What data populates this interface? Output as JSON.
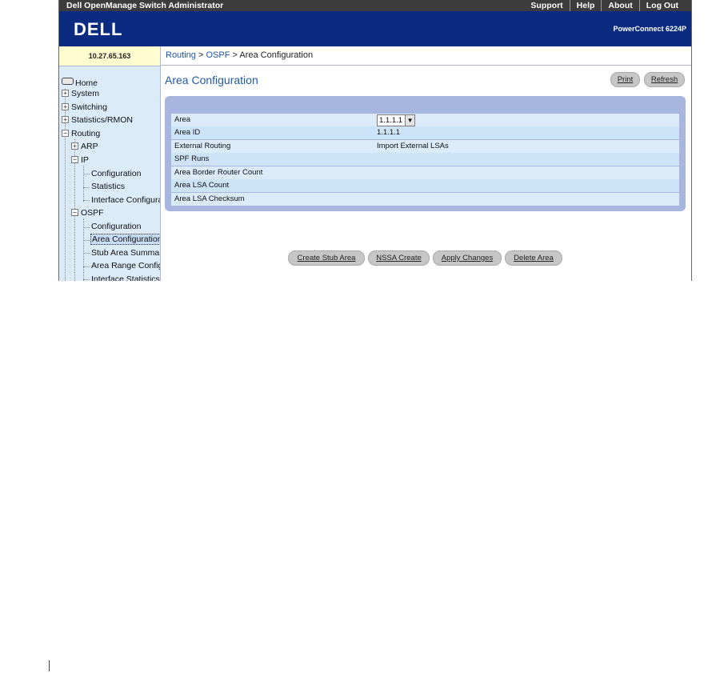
{
  "topbar": {
    "app_title": "Dell OpenManage Switch Administrator",
    "links": [
      "Support",
      "Help",
      "About",
      "Log Out"
    ]
  },
  "banner": {
    "logo_text": "DELL",
    "model": "PowerConnect 6224P"
  },
  "ip_address": "10.27.65.163",
  "breadcrumb": {
    "items": [
      "Routing",
      "OSPF"
    ],
    "current": "Area Configuration",
    "separator": ">"
  },
  "sidebar": {
    "home": "Home",
    "system": "System",
    "switching": "Switching",
    "statistics": "Statistics/RMON",
    "routing": "Routing",
    "arp": "ARP",
    "ip": "IP",
    "ip_configuration": "Configuration",
    "ip_statistics": "Statistics",
    "ip_interface_configuration": "Interface Configuration",
    "ospf": "OSPF",
    "ospf_configuration": "Configuration",
    "ospf_area_configuration": "Area Configuration",
    "ospf_stub_area_summary": "Stub Area Summary",
    "ospf_area_range_configuration": "Area Range Configuration",
    "ospf_interface_statistics": "Interface Statistics",
    "expander_plus": "+",
    "expander_minus": "−"
  },
  "page": {
    "title": "Area Configuration",
    "print_label": "Print",
    "refresh_label": "Refresh"
  },
  "form": {
    "area_label": "Area",
    "area_value": "1.1.1.1",
    "area_id_label": "Area ID",
    "area_id_value": "1.1.1.1",
    "external_routing_label": "External Routing",
    "external_routing_value": "Import External LSAs",
    "spf_runs_label": "SPF Runs",
    "abr_count_label": "Area Border Router Count",
    "lsa_count_label": "Area LSA Count",
    "lsa_checksum_label": "Area LSA Checksum"
  },
  "actions": {
    "create_stub": "Create Stub Area",
    "nssa_create": "NSSA Create",
    "apply_changes": "Apply Changes",
    "delete_area": "Delete Area"
  },
  "colors": {
    "banner": "#0b2b80",
    "topbar": "#3c3c3c",
    "title": "#1f5aa6",
    "panel": "#a7b6de",
    "sidebar": "#dcebf9",
    "ip_box": "#fffccf"
  }
}
